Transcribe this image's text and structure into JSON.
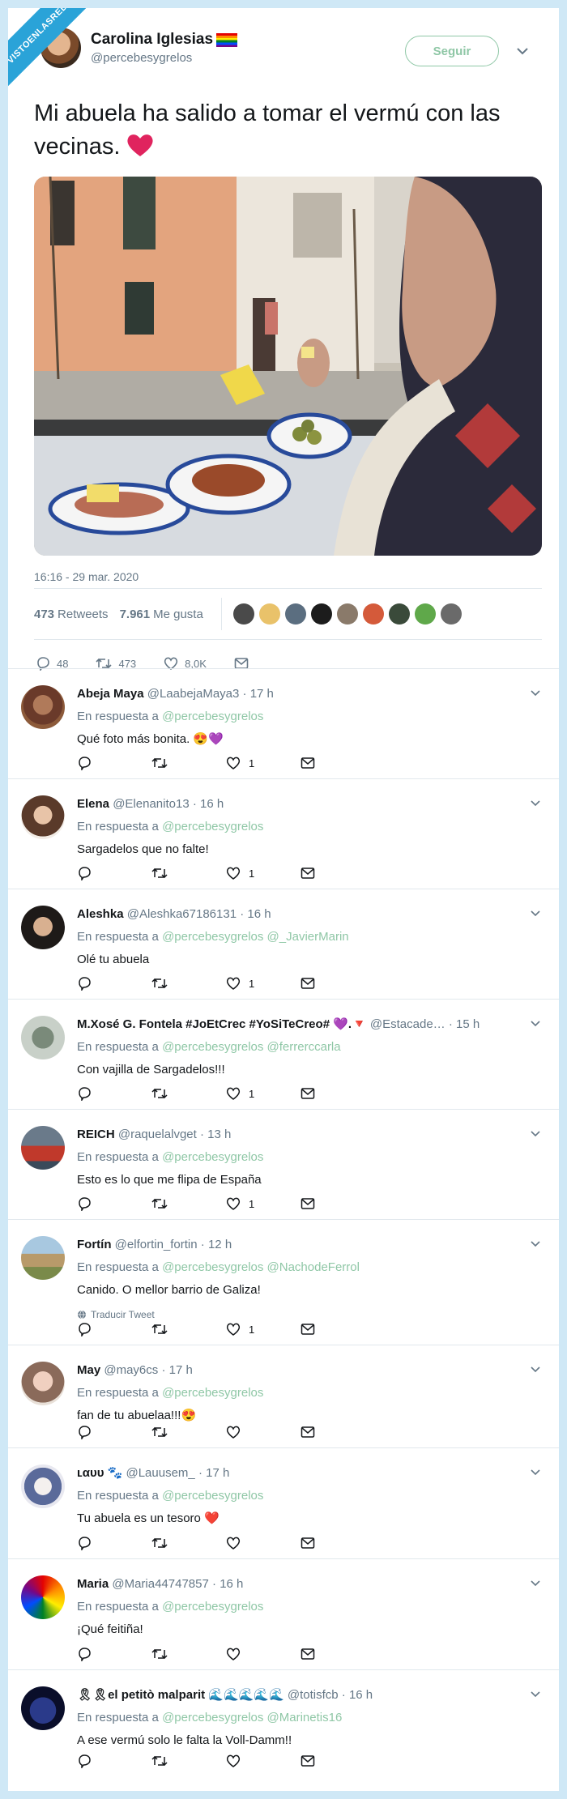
{
  "watermark": "VISTOENLASREDES .com",
  "tweet": {
    "author_name": "Carolina Iglesias",
    "author_handle": "@percebesygrelos",
    "follow_label": "Seguir",
    "text": "Mi abuela ha salido a tomar el vermú con las vecinas.",
    "timestamp": "16:16 - 29 mar. 2020",
    "retweets_count": "473",
    "retweets_label": "Retweets",
    "likes_count": "7.961",
    "likes_label": "Me gusta",
    "actions": {
      "replies": "48",
      "retweets": "473",
      "likes": "8,0K"
    }
  },
  "replies": [
    {
      "name": "Abeja Maya",
      "handle": "@LaabejaMaya3",
      "time": "17 h",
      "in_reply_prefix": "En respuesta a",
      "in_reply_to": "@percebesygrelos",
      "text": "Qué foto más bonita. 😍💜",
      "likes": "1"
    },
    {
      "name": "Elena",
      "handle": "@Elenanito13",
      "time": "16 h",
      "in_reply_prefix": "En respuesta a",
      "in_reply_to": "@percebesygrelos",
      "text": "Sargadelos que no falte!",
      "likes": "1"
    },
    {
      "name": "Aleshka",
      "handle": "@Aleshka67186131",
      "time": "16 h",
      "in_reply_prefix": "En respuesta a",
      "in_reply_to": "@percebesygrelos @_JavierMarin",
      "text": "Olé tu abuela",
      "likes": "1"
    },
    {
      "name": "M.Xosé G. Fontela #JoEtCrec #YoSiTeCreo# 💜.🔻",
      "handle": "@Estacade…",
      "time": "15 h",
      "in_reply_prefix": "En respuesta a",
      "in_reply_to": "@percebesygrelos @ferrerccarla",
      "text": "Con vajilla de Sargadelos!!!",
      "likes": "1"
    },
    {
      "name": "REICH",
      "handle": "@raquelalvget",
      "time": "13 h",
      "in_reply_prefix": "En respuesta a",
      "in_reply_to": "@percebesygrelos",
      "text": "Esto es lo que me flipa de España",
      "likes": "1"
    },
    {
      "name": "Fortín",
      "handle": "@elfortin_fortin",
      "time": "12 h",
      "in_reply_prefix": "En respuesta a",
      "in_reply_to": "@percebesygrelos @NachodeFerrol",
      "text": "Canido. O mellor barrio de Galiza!",
      "translate": "Traducir Tweet",
      "likes": "1"
    },
    {
      "name": "May",
      "handle": "@may6cs",
      "time": "17 h",
      "in_reply_prefix": "En respuesta a",
      "in_reply_to": "@percebesygrelos",
      "text": "fan de tu abuelaa!!!😍",
      "likes": ""
    },
    {
      "name": "ʟαυυ 🐾",
      "handle": "@Lauusem_",
      "time": "17 h",
      "in_reply_prefix": "En respuesta a",
      "in_reply_to": "@percebesygrelos",
      "text": "Tu abuela es un tesoro ❤️",
      "likes": ""
    },
    {
      "name": "Maria",
      "handle": "@Maria44747857",
      "time": "16 h",
      "in_reply_prefix": "En respuesta a",
      "in_reply_to": "@percebesygrelos",
      "text": "¡Qué feitiña!",
      "likes": ""
    },
    {
      "name": "🎗🎗el petitò malparit 🌊🌊🌊🌊🌊",
      "handle": "@totisfcb",
      "time": "16 h",
      "in_reply_prefix": "En respuesta a",
      "in_reply_to": "@percebesygrelos @Marinetis16",
      "text": "A ese vermú solo le falta la Voll-Damm!!",
      "likes": ""
    }
  ],
  "colors": {
    "accent_green": "#8fc7a6",
    "muted": "#657786",
    "background": "#cfe8f6",
    "heart": "#e0245e"
  },
  "icons": [
    "reply-icon",
    "retweet-icon",
    "like-icon",
    "message-icon",
    "chevron-down-icon",
    "globe-icon"
  ]
}
